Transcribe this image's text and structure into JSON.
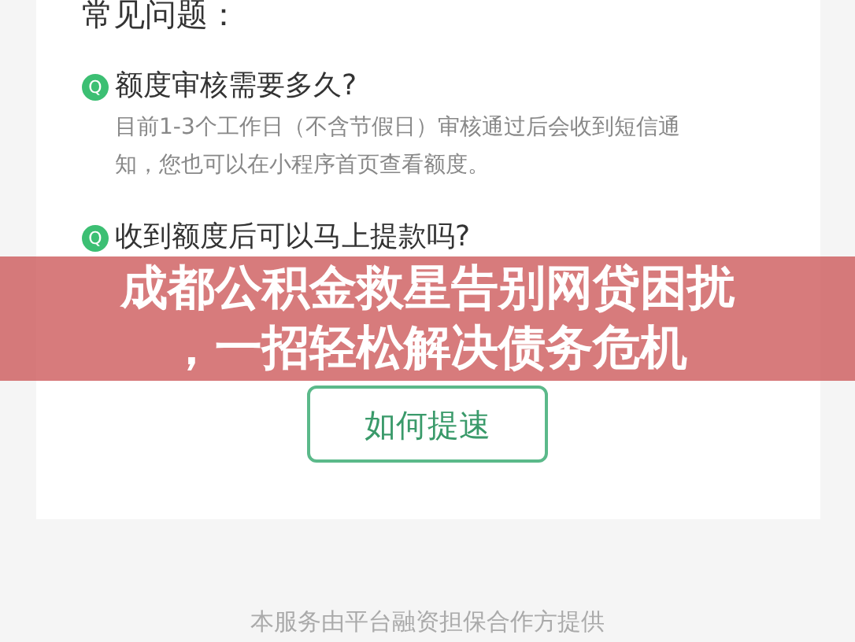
{
  "faq": {
    "heading": "常见问题：",
    "items": [
      {
        "marker": "Q",
        "question": "额度审核需要多久?",
        "answer_lines": [
          "目前1-3个工作日（不含节假日）审核通过后会收到短信通",
          "知，您也可以在小程序首页查看额度。"
        ]
      },
      {
        "marker": "Q",
        "question": "收到额度后可以马上提款吗?"
      }
    ],
    "button": "如何提速"
  },
  "footer": "本服务由平台融资担保合作方提供",
  "banner": {
    "title_lines": [
      "成都公积金救星告别网贷困扰",
      "，一招轻松解决债务危机"
    ]
  }
}
